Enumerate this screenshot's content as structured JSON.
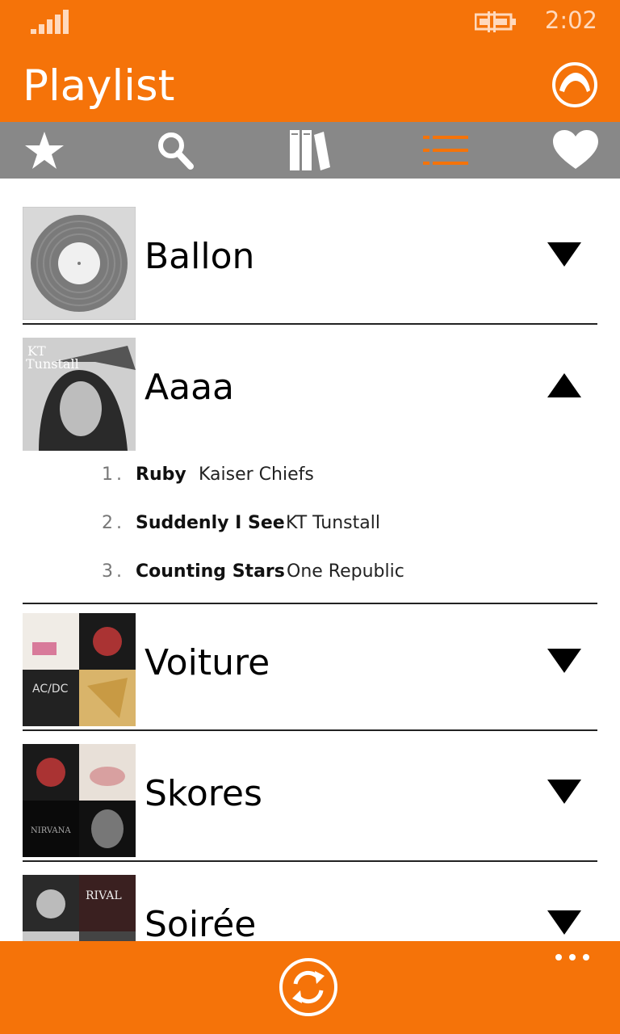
{
  "status_bar": {
    "time": "2:02"
  },
  "header": {
    "title": "Playlist"
  },
  "tabs": [
    {
      "name": "favorites",
      "icon": "star-icon",
      "active": false
    },
    {
      "name": "search",
      "icon": "search-icon",
      "active": false
    },
    {
      "name": "library",
      "icon": "library-icon",
      "active": false
    },
    {
      "name": "playlist",
      "icon": "list-icon",
      "active": true
    },
    {
      "name": "liked",
      "icon": "heart-icon",
      "active": false
    }
  ],
  "playlists": [
    {
      "name": "Ballon",
      "expanded": false
    },
    {
      "name": "Aaaa",
      "expanded": true,
      "tracks": [
        {
          "number": "1",
          "title": "Ruby",
          "artist": "Kaiser Chiefs"
        },
        {
          "number": "2",
          "title": "Suddenly I See",
          "artist": "KT Tunstall"
        },
        {
          "number": "3",
          "title": "Counting Stars",
          "artist": "One Republic"
        }
      ]
    },
    {
      "name": "Voiture",
      "expanded": false
    },
    {
      "name": "Skores",
      "expanded": false
    },
    {
      "name": "Soirée",
      "expanded": false
    }
  ],
  "colors": {
    "accent": "#f57309",
    "tabbar": "#888888"
  }
}
